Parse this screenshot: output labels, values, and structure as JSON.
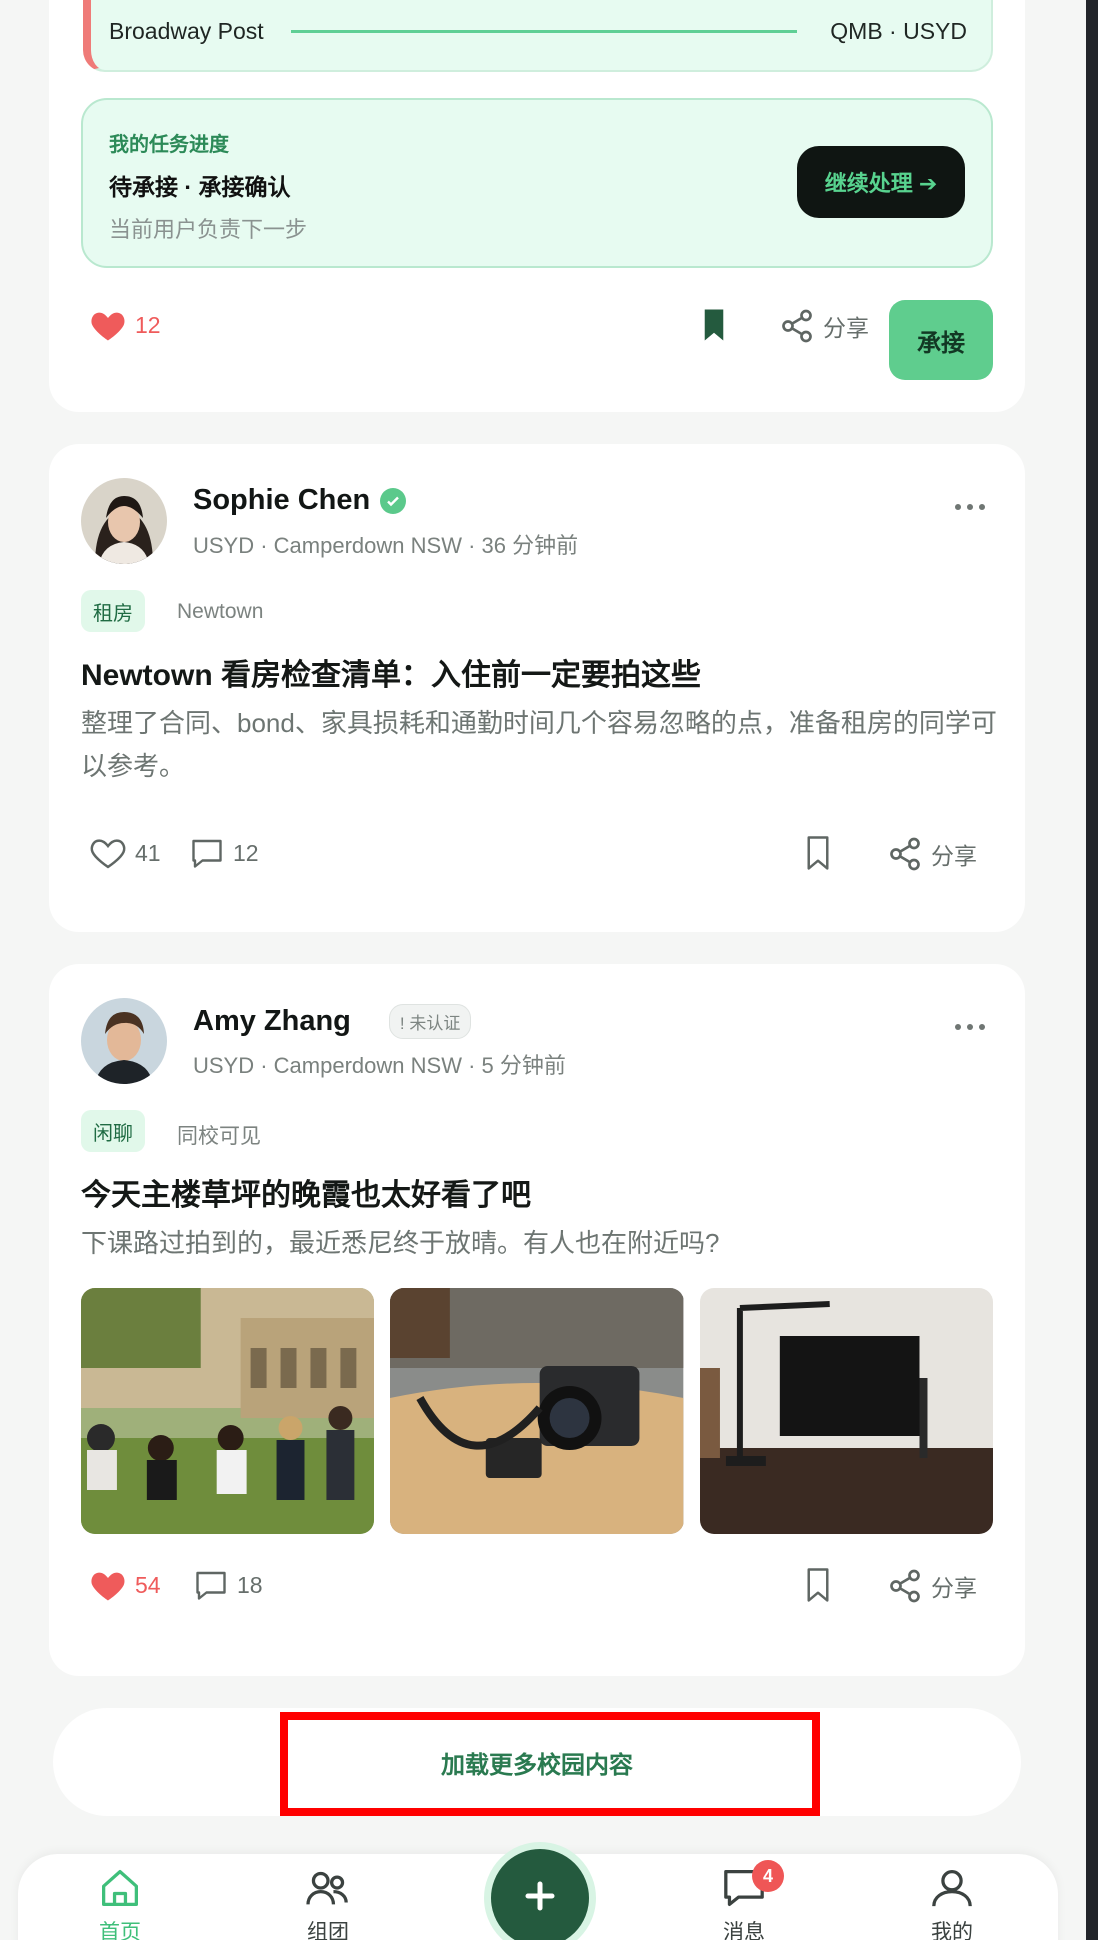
{
  "task_card": {
    "route_from": "Broadway Post",
    "route_to": "QMB · USYD",
    "progress_title": "我的任务进度",
    "status": "待承接 · 承接确认",
    "description": "当前用户负责下一步",
    "continue_label": "继续处理 ➔",
    "likes": "12",
    "share_label": "分享",
    "accept_label": "承接"
  },
  "posts": [
    {
      "author": "Sophie Chen",
      "verified": true,
      "meta": "USYD · Camperdown NSW · 36 分钟前",
      "tag": "租房",
      "subtag": "Newtown",
      "title": "Newtown 看房检查清单：入住前一定要拍这些",
      "body": "整理了合同、bond、家具损耗和通勤时间几个容易忽略的点，准备租房的同学可以参考。",
      "likes": "41",
      "comments": "12",
      "share_label": "分享"
    },
    {
      "author": "Amy Zhang",
      "verified": false,
      "unverified_label": "! 未认证",
      "meta": "USYD · Camperdown NSW · 5 分钟前",
      "tag": "闲聊",
      "subtag": "同校可见",
      "title": "今天主楼草坪的晚霞也太好看了吧",
      "body": "下课路过拍到的，最近悉尼终于放晴。有人也在附近吗?",
      "likes": "54",
      "comments": "18",
      "share_label": "分享"
    }
  ],
  "load_more_label": "加载更多校园内容",
  "nav": {
    "home": "首页",
    "groups": "组团",
    "messages": "消息",
    "messages_badge": "4",
    "profile": "我的"
  },
  "colors": {
    "accent_green": "#5fcd8e",
    "like_red": "#ef5b5b",
    "dark_green": "#245a3e"
  }
}
